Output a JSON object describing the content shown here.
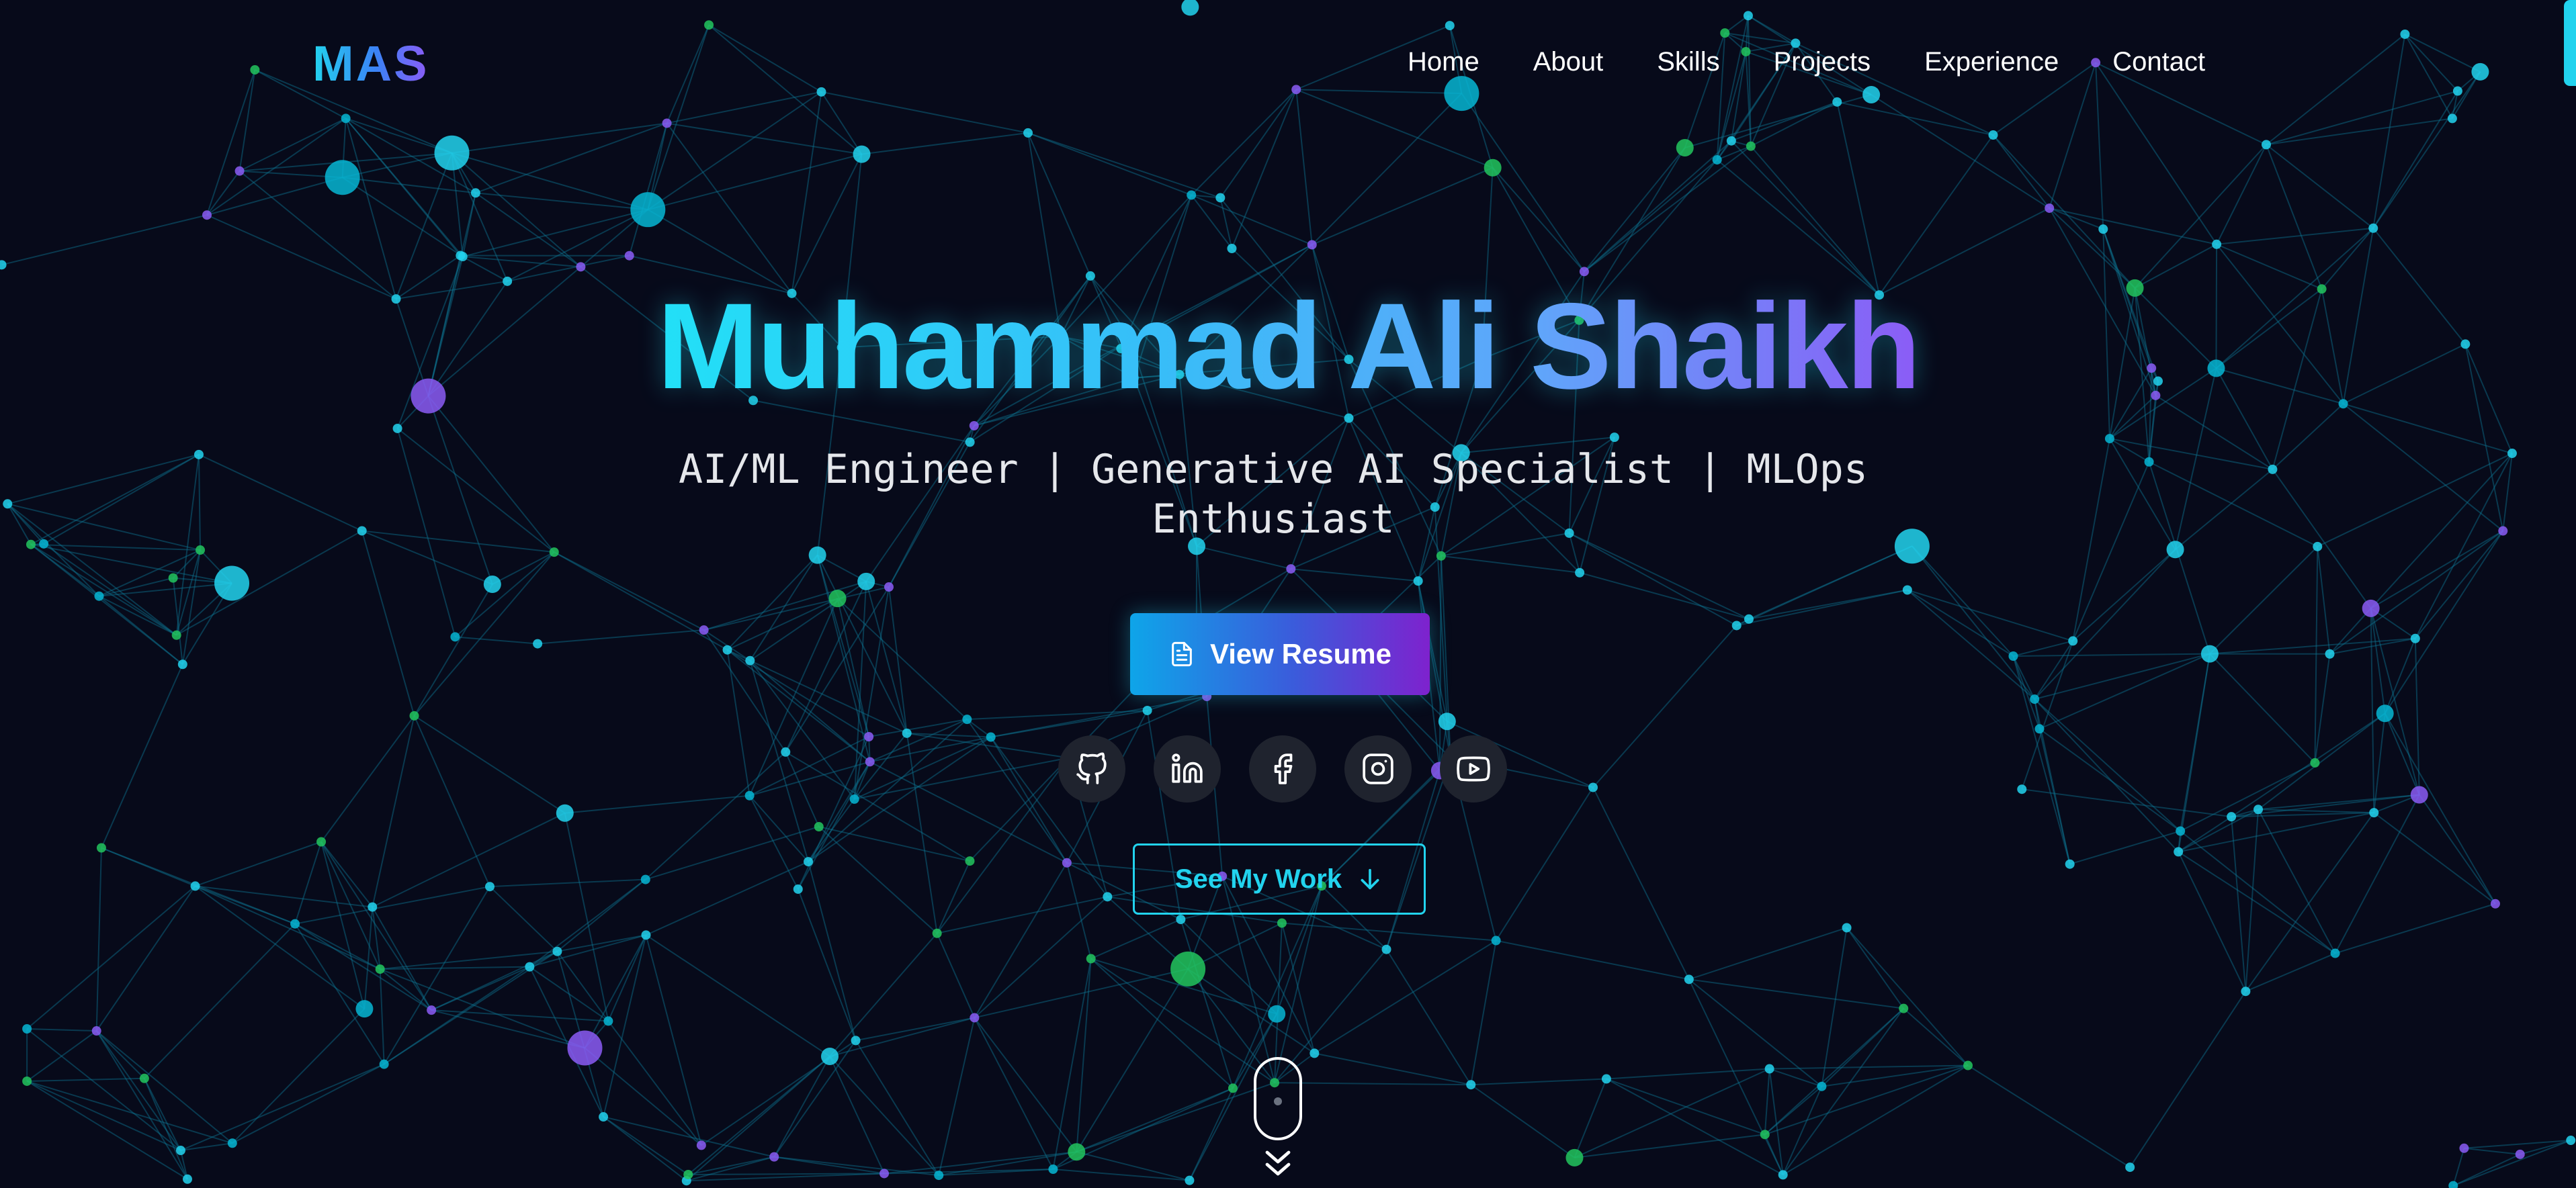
{
  "brand": {
    "logo": "MAS"
  },
  "nav": {
    "items": [
      "Home",
      "About",
      "Skills",
      "Projects",
      "Experience",
      "Contact"
    ]
  },
  "hero": {
    "name": "Muhammad Ali Shaikh",
    "subtitle_line1": "AI/ML Engineer | Generative AI Specialist | MLOps",
    "subtitle_line2": "Enthusiast",
    "resume_button": {
      "label": "View Resume",
      "icon": "file-text-icon"
    },
    "work_button": {
      "label": "See My Work",
      "icon": "arrow-down-icon"
    }
  },
  "socials": [
    {
      "name": "github",
      "icon": "github-icon"
    },
    {
      "name": "linkedin",
      "icon": "linkedin-icon"
    },
    {
      "name": "facebook",
      "icon": "facebook-icon"
    },
    {
      "name": "instagram",
      "icon": "instagram-icon"
    },
    {
      "name": "youtube",
      "icon": "youtube-icon"
    }
  ],
  "colors": {
    "background": "#070a1a",
    "accent_cyan": "#22d3ee",
    "accent_blue": "#3b82f6",
    "accent_purple": "#8b5cf6",
    "particle_green": "#22c55e"
  }
}
